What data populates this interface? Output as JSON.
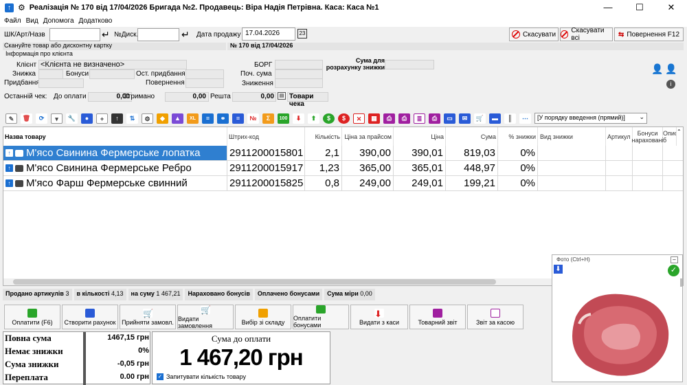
{
  "window": {
    "title": "Реалізація № 170 від 17/04/2026 Бригада №2. Продавець: Віра Надія Петрівна. Каса: Каса №1"
  },
  "menu": [
    "Файл",
    "Вид",
    "Допомога",
    "Додатково"
  ],
  "search": {
    "label": "ШК/Арт/Назв",
    "value": "",
    "disc_label": "№Диск.",
    "disc_value": "",
    "date_label": "Дата продажу",
    "date_value": "17.04.2026"
  },
  "top_buttons": {
    "cancel": "Скасувати",
    "cancel_all": "Скасувати всі",
    "return": "Повернення F12"
  },
  "hints": {
    "scan": "Скануйте товар або дисконтну картку",
    "doc": "№ 170 від 17/04/2026"
  },
  "client": {
    "section": "Інформація про клієнта",
    "client_label": "Клієнт",
    "client_value": "<Клієнта не визначено>",
    "discount_label": "Знижка",
    "bonus_label": "Бонуси",
    "last_purchase_label": "Ост. придбання",
    "purchase_label": "Придбання",
    "return_label": "Повернення",
    "debt_label": "БОРГ",
    "start_sum_label": "Поч. сума",
    "reduction_label": "Зниження",
    "calc_sum_label": "Сума для розрахунку знижки"
  },
  "check": {
    "last_label": "Останній чек:",
    "to_pay_label": "До оплати",
    "to_pay": "0,00",
    "received_label": "Отримано",
    "received": "0,00",
    "change_label": "Решта",
    "change": "0,00",
    "goods_label": "Товари чека"
  },
  "sort_select": "[У порядку введення (прямий)]",
  "columns": [
    "Назва товару",
    "Штрих-код",
    "Кількість",
    "Ціна за прайсом",
    "Ціна",
    "Сума",
    "% знижки",
    "Вид знижки",
    "Артикул",
    "Бонуси нараховані",
    "Опис б"
  ],
  "rows": [
    {
      "name": "М'ясо Свинина Фермерське лопатка",
      "barcode": "2911200015801",
      "qty": "2,1",
      "price_list": "390,00",
      "price": "390,01",
      "sum": "819,03",
      "disc": "0%"
    },
    {
      "name": "М'ясо Свинина Фермерське Ребро",
      "barcode": "2911200015917",
      "qty": "1,23",
      "price_list": "365,00",
      "price": "365,01",
      "sum": "448,97",
      "disc": "0%"
    },
    {
      "name": "М'ясо Фарш Фермерське свинний",
      "barcode": "2911200015825",
      "qty": "0,8",
      "price_list": "249,00",
      "price": "249,01",
      "sum": "199,21",
      "disc": "0%"
    }
  ],
  "status": {
    "sold_label": "Продано артикулів",
    "sold": "3",
    "qty_label": "в кількості",
    "qty": "4,13",
    "sum_label": "на суму",
    "sum": "1 467,21",
    "bonus_acc": "Нараховано бонусів",
    "bonus_paid": "Оплачено бонусами",
    "measure_label": "Сума міри",
    "measure": "0,00"
  },
  "actions": [
    "Оплатити (F6)",
    "Створити рахунок",
    "Прийняти замовл.",
    "Видати замовлення",
    "Вибір зі складу",
    "Оплатити бонусами",
    "Видати з каси",
    "Товарний звіт",
    "Звіт за касою"
  ],
  "totals": [
    {
      "label": "Повна сума",
      "value": "1467,15 грн"
    },
    {
      "label": "Немає знижки",
      "value": "0%"
    },
    {
      "label": "Сума знижки",
      "value": "-0,05 грн"
    },
    {
      "label": "Переплата",
      "value": "0.00 грн"
    }
  ],
  "payment": {
    "label": "Сума до оплати",
    "value": "1 467,20 грн",
    "ask_qty": "Запитувати кількість товару"
  },
  "photo": {
    "title": "Фото (Ctrl+H)"
  },
  "colors": {
    "selection": "#2f7fd0",
    "accent": "#1a6fd1"
  }
}
